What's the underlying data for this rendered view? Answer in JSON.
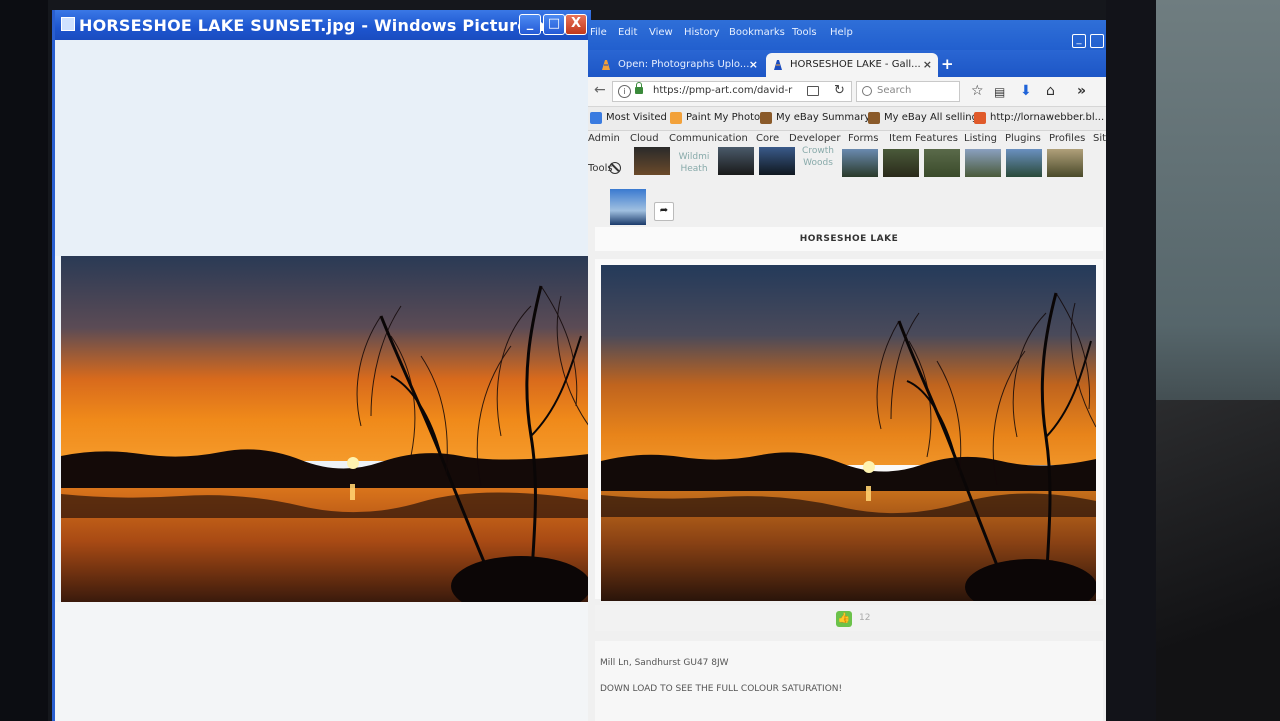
{
  "viewer": {
    "title": "HORSESHOE LAKE SUNSET.jpg - Windows Picture and ...",
    "minimize": "_",
    "maximize": "□",
    "close": "X"
  },
  "browser": {
    "menu": [
      "File",
      "Edit",
      "View",
      "History",
      "Bookmarks",
      "Tools",
      "Help"
    ],
    "tabs": [
      {
        "label": "Open: Photographs Uplo...",
        "close": "×"
      },
      {
        "label": "HORSESHOE LAKE - Gall...",
        "close": "×"
      }
    ],
    "new_tab": "+",
    "url": "https://pmp-art.com/david-r",
    "search_placeholder": "Search",
    "bookmarks": [
      "Most Visited",
      "Paint My Photo",
      "My eBay Summary",
      "My eBay All selling",
      "http://lornawebber.bl..."
    ],
    "admin_bar": [
      "Admin",
      "Cloud",
      "Communication",
      "Core",
      "Developer",
      "Forms",
      "Item Features",
      "Listing",
      "Plugins",
      "Profiles",
      "Sit"
    ],
    "tools_label": "Tools",
    "thumb_labels": {
      "wildmi_heath": "Wildmi Heath",
      "crowth_woods": "Crowth Woods"
    },
    "share_icon": "➦"
  },
  "gallery": {
    "title": "HORSESHOE LAKE",
    "like_count": "12",
    "location": "Mill Ln, Sandhurst GU47 8JW",
    "description": "DOWN LOAD TO SEE THE FULL COLOUR SATURATION!"
  },
  "colors": {
    "xp_title_blue": "#1d55cf",
    "firefox_blue": "#1f5ccc",
    "like_green": "#6cc24a"
  }
}
